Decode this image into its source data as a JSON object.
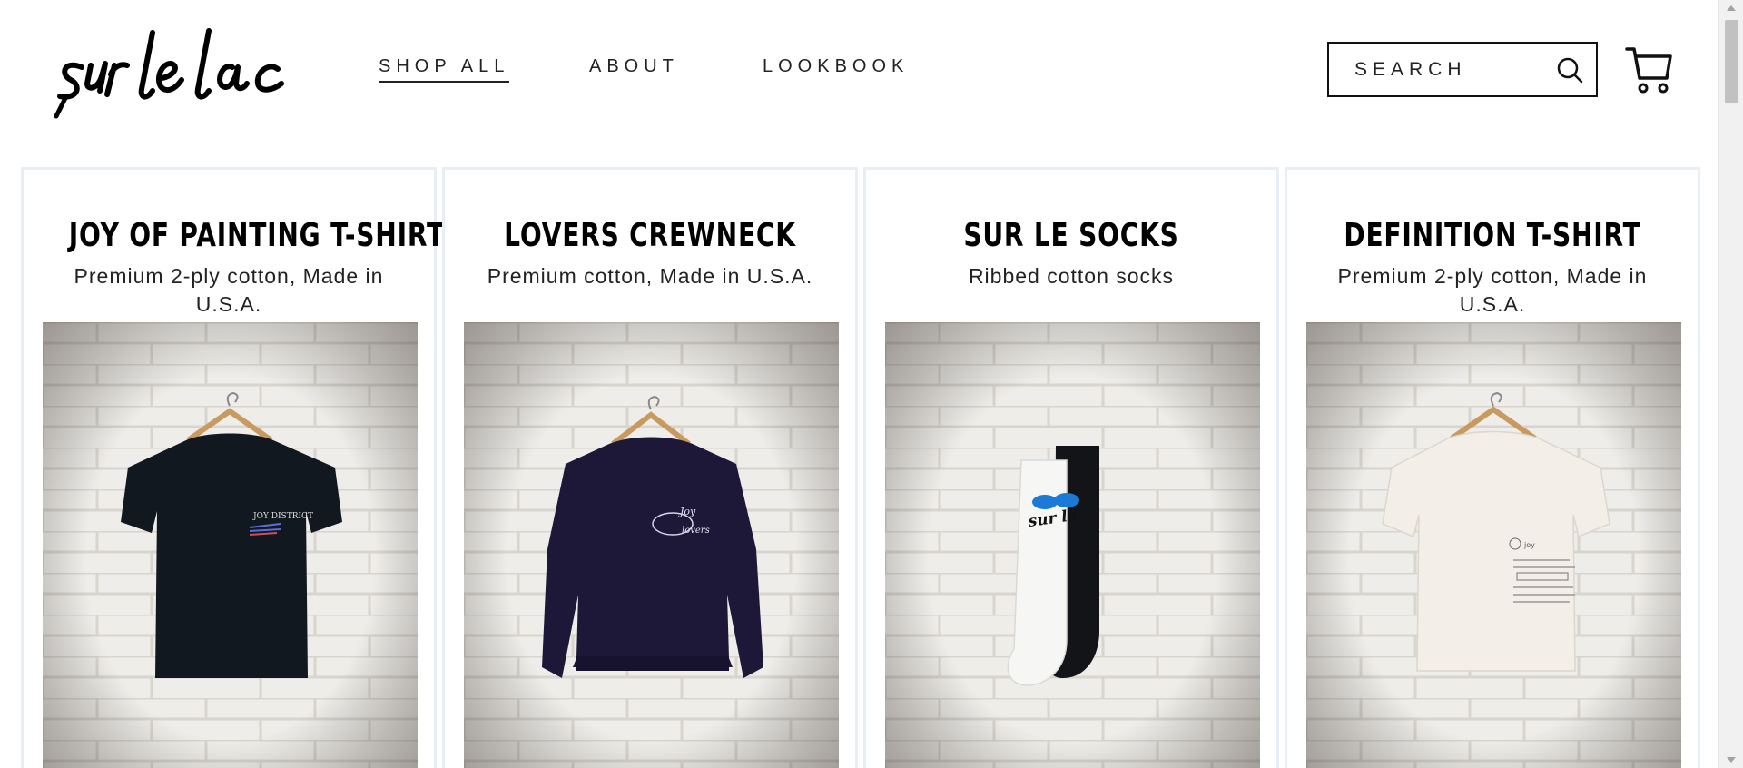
{
  "header": {
    "brand_name": "sur le lac",
    "nav": [
      {
        "label": "SHOP ALL"
      },
      {
        "label": "ABOUT"
      },
      {
        "label": "LOOKBOOK"
      }
    ],
    "search": {
      "placeholder": "SEARCH",
      "icon": "search-icon"
    },
    "cart": {
      "icon": "cart-icon"
    }
  },
  "products": [
    {
      "title": "JOY OF PAINTING T-SHIRT",
      "description": "Premium 2-ply cotton, Made in U.S.A.",
      "image": "black-tshirt-on-hanger"
    },
    {
      "title": "LOVERS CREWNECK",
      "description": "Premium cotton, Made in U.S.A.",
      "image": "navy-crewneck-on-hanger"
    },
    {
      "title": "SUR LE SOCKS",
      "description": "Ribbed cotton socks",
      "image": "black-and-white-socks"
    },
    {
      "title": "DEFINITION T-SHIRT",
      "description": "Premium 2-ply cotton, Made in U.S.A.",
      "image": "white-tshirt-on-hanger"
    }
  ],
  "colors": {
    "card_border": "#e7eef4",
    "text": "#111111",
    "brick": "#ece9e4"
  }
}
